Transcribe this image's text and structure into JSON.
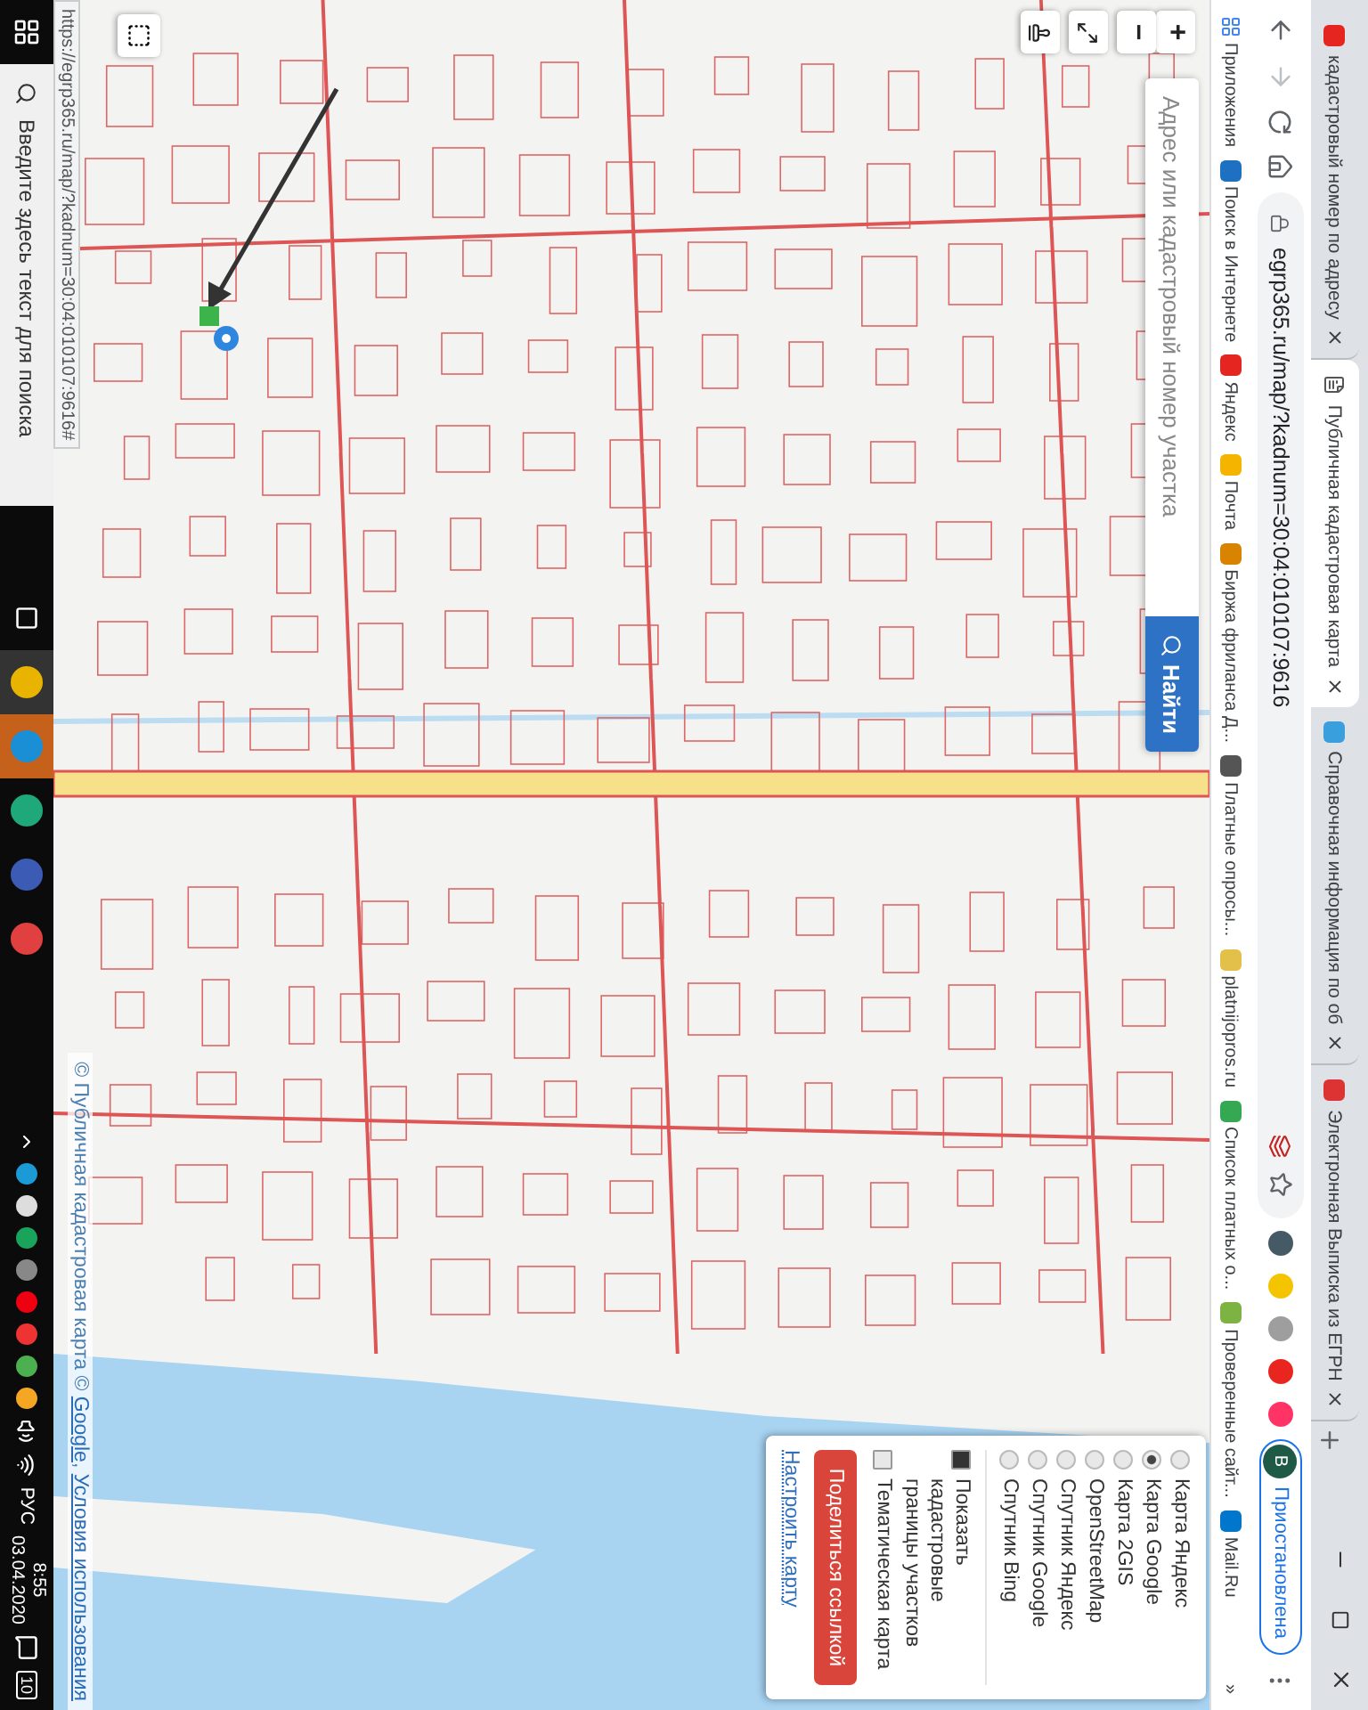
{
  "browser": {
    "tabs": [
      {
        "title": "кадастровый номер по адресу",
        "selected": false
      },
      {
        "title": "Публичная кадастровая карта",
        "selected": true
      },
      {
        "title": "Справочная информация по об",
        "selected": false
      },
      {
        "title": "Электронная Выписка из ЕГРН",
        "selected": false
      }
    ],
    "forward_disabled": true,
    "url": "egrp365.ru/map/?kadnum=30:04:010107:9616",
    "profile": {
      "initial": "В",
      "status": "Приостановлена"
    },
    "bookmarks": [
      "Приложения",
      "Поиск в Интернете",
      "Яндекс",
      "Почта",
      "Биржа фриланса Д...",
      "Платные опросы...",
      "platnijopros.ru",
      "Список платных о...",
      "Проверенные сайт...",
      "Mail.Ru"
    ],
    "bookmarks_more": "»"
  },
  "map": {
    "search": {
      "placeholder": "Адрес или кадастровый номер участка",
      "button": "Найти"
    },
    "zoom_in": "+",
    "zoom_out": "−",
    "layers": {
      "base_maps": [
        {
          "label": "Карта Яндекс",
          "selected": false
        },
        {
          "label": "Карта Google",
          "selected": true
        },
        {
          "label": "Карта 2GIS",
          "selected": false
        },
        {
          "label": "OpenStreetMap",
          "selected": false
        },
        {
          "label": "Спутник Яндекс",
          "selected": false
        },
        {
          "label": "Спутник Google",
          "selected": false
        },
        {
          "label": "Спутник Bing",
          "selected": false
        }
      ],
      "overlays": [
        {
          "label": "Показать кадастровые границы участков",
          "checked": true
        },
        {
          "label": "Тематическая карта",
          "checked": false
        }
      ],
      "share_button": "Поделиться ссылкой",
      "settings_link": "Настроить карту"
    },
    "attribution": [
      {
        "text": "© Публичная кадастровая карта © ",
        "link": false
      },
      {
        "text": "Google",
        "link": true
      },
      {
        "text": ", ",
        "link": false
      },
      {
        "text": "Условия использования",
        "link": true
      }
    ],
    "status_url": "https://egrp365.ru/map/?kadnum=30:04:010107:9616#"
  },
  "taskbar": {
    "search_placeholder": "Введите здесь текст для поиска",
    "language": "РУС",
    "time": "8:55",
    "date": "03.04.2020",
    "notifications": "10"
  }
}
